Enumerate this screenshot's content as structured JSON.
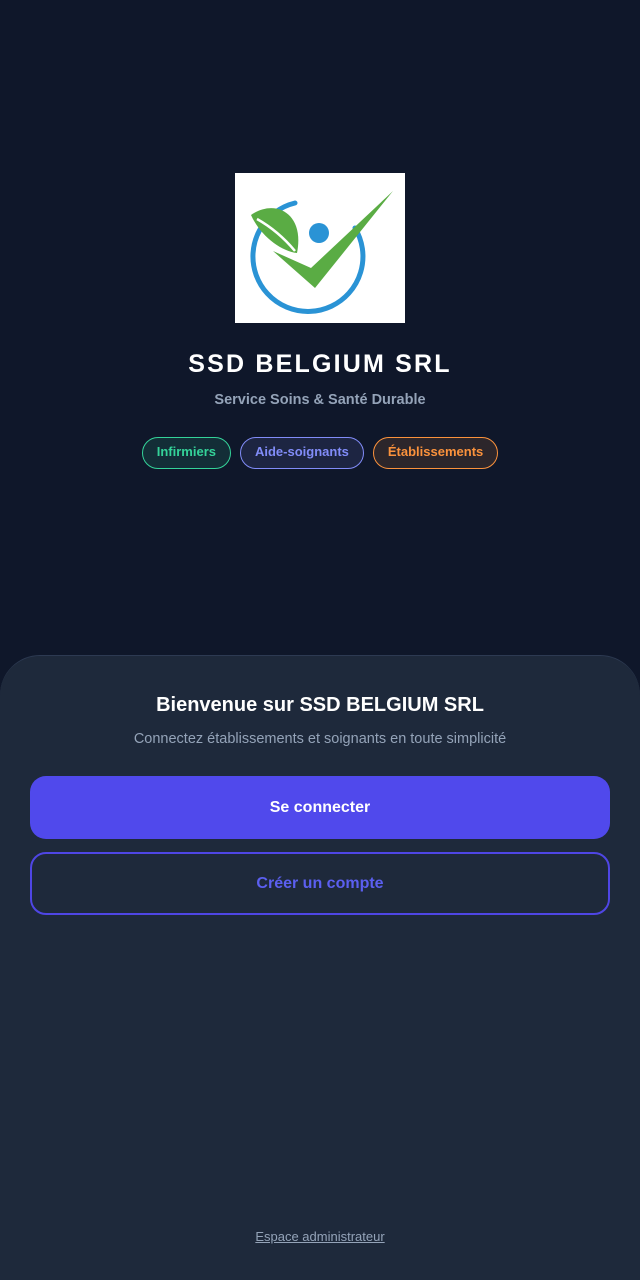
{
  "brand": {
    "title": "SSD BELGIUM SRL",
    "subtitle": "Service Soins & Santé Durable",
    "logo_icon": "leaf-checkmark-person-logo"
  },
  "tags": [
    {
      "label": "Infirmiers",
      "color": "#34d399"
    },
    {
      "label": "Aide-soignants",
      "color": "#818cf8"
    },
    {
      "label": "Établissements",
      "color": "#fb923c"
    }
  ],
  "welcome": {
    "title": "Bienvenue sur SSD BELGIUM SRL",
    "subtitle": "Connectez établissements et soignants en toute simplicité"
  },
  "actions": {
    "login_label": "Se connecter",
    "register_label": "Créer un compte"
  },
  "footer": {
    "admin_link": "Espace administrateur"
  },
  "colors": {
    "background": "#0f172a",
    "sheet": "#1e293b",
    "accent": "#4f46e5"
  }
}
